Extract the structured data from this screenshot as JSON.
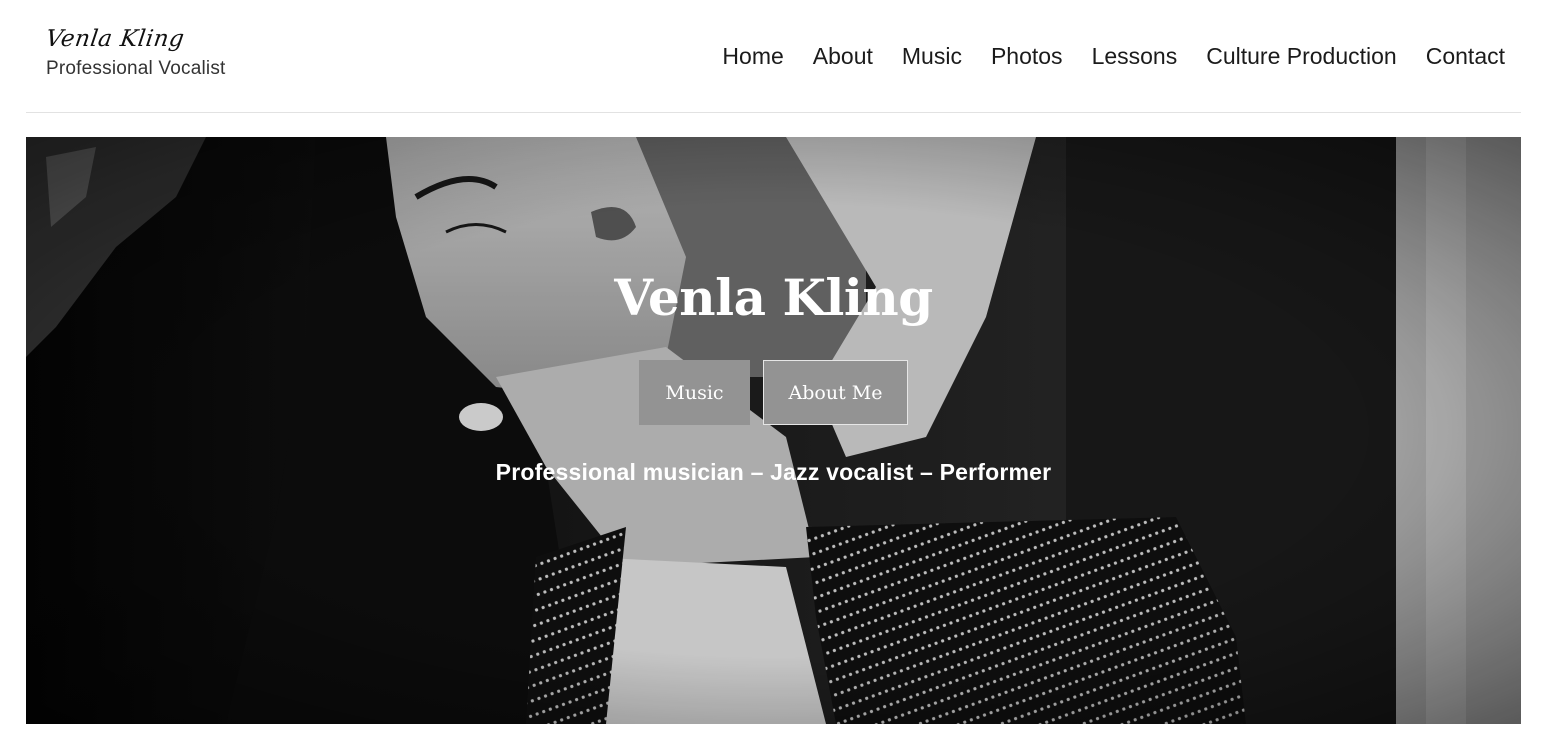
{
  "site": {
    "name": "Venla Kling",
    "tagline": "Professional Vocalist"
  },
  "nav": {
    "items": [
      {
        "label": "Home"
      },
      {
        "label": "About"
      },
      {
        "label": "Music"
      },
      {
        "label": "Photos"
      },
      {
        "label": "Lessons"
      },
      {
        "label": "Culture Production"
      },
      {
        "label": "Contact"
      }
    ]
  },
  "hero": {
    "title": "Venla Kling",
    "buttons": {
      "music": "Music",
      "about": "About Me"
    },
    "subtitle": "Professional musician – Jazz vocalist – Performer",
    "image": "black-and-white portrait of vocalist"
  },
  "colors": {
    "button_bg": "#939393",
    "text_dark": "#1b1b1b",
    "hero_text": "#ffffff"
  }
}
